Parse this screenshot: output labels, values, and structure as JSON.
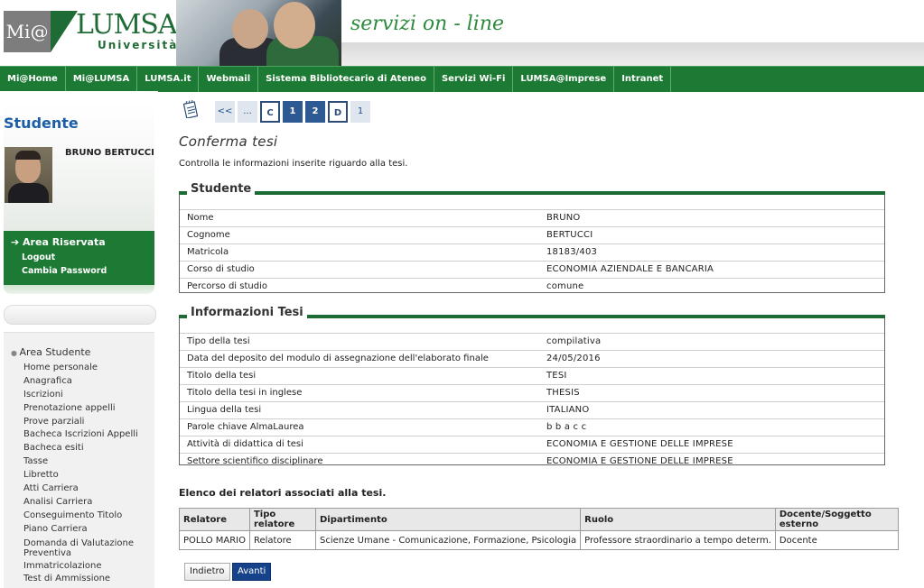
{
  "header": {
    "logo_left": "Mi@",
    "logo_main": "LUMSA",
    "logo_sub": "Università",
    "tagline": "servizi on - line"
  },
  "topnav": [
    "Mi@Home",
    "Mi@LUMSA",
    "LUMSA.it",
    "Webmail",
    "Sistema Bibliotecario di Ateneo",
    "Servizi Wi-Fi",
    "LUMSA@Imprese",
    "Intranet"
  ],
  "sidebar": {
    "title": "Studente",
    "student_name": "BRUNO BERTUCCI",
    "area_title": "Area Riservata",
    "area_links": [
      "Logout",
      "Cambia Password"
    ],
    "menu_head": "Area Studente",
    "menu_items": [
      "Home personale",
      "Anagrafica",
      "Iscrizioni",
      "Prenotazione appelli",
      "Prove parziali",
      "Bacheca Iscrizioni Appelli",
      "Bacheca esiti",
      "Tasse",
      "Libretto",
      "Atti Carriera",
      "Analisi Carriera",
      "Conseguimento Titolo",
      "Piano Carriera",
      "Domanda di Valutazione Preventiva",
      "Immatricolazione",
      "Test di Ammissione"
    ]
  },
  "pager": [
    "<<",
    "...",
    "C",
    "1",
    "2",
    "D",
    "1"
  ],
  "main": {
    "title": "Conferma tesi",
    "intro": "Controlla le informazioni inserite riguardo alla tesi."
  },
  "studente": {
    "legend": "Studente",
    "rows": [
      {
        "k": "Nome",
        "v": "BRUNO"
      },
      {
        "k": "Cognome",
        "v": "BERTUCCI"
      },
      {
        "k": "Matricola",
        "v": "18183/403"
      },
      {
        "k": "Corso di studio",
        "v": "ECONOMIA AZIENDALE E BANCARIA"
      },
      {
        "k": "Percorso di studio",
        "v": "comune"
      }
    ]
  },
  "tesi": {
    "legend": "Informazioni Tesi",
    "rows": [
      {
        "k": "Tipo della tesi",
        "v": "compilativa"
      },
      {
        "k": "Data del deposito del modulo di assegnazione dell'elaborato finale",
        "v": "24/05/2016"
      },
      {
        "k": "Titolo della tesi",
        "v": "TESI"
      },
      {
        "k": "Titolo della tesi in inglese",
        "v": "THESIS"
      },
      {
        "k": "Lingua della tesi",
        "v": "ITALIANO"
      },
      {
        "k": "Parole chiave AlmaLaurea",
        "v": "b b a c c"
      },
      {
        "k": "Attività di didattica di tesi",
        "v": "ECONOMIA E GESTIONE DELLE IMPRESE"
      },
      {
        "k": "Settore scientifico disciplinare",
        "v": "ECONOMIA E GESTIONE DELLE IMPRESE"
      }
    ]
  },
  "relatori": {
    "title": "Elenco dei relatori associati alla tesi.",
    "headers": [
      "Relatore",
      "Tipo relatore",
      "Dipartimento",
      "Ruolo",
      "Docente/Soggetto esterno"
    ],
    "rows": [
      [
        "POLLO MARIO",
        "Relatore",
        "Scienze Umane - Comunicazione, Formazione, Psicologia",
        "Professore straordinario a tempo determ.",
        "Docente"
      ]
    ]
  },
  "buttons": {
    "back": "Indietro",
    "next": "Avanti"
  }
}
